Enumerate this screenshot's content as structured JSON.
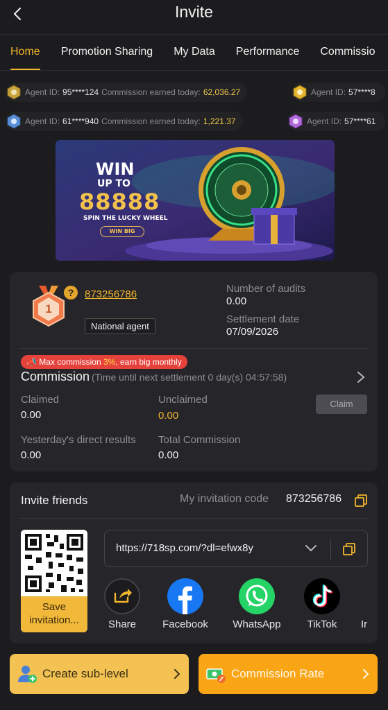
{
  "header": {
    "title": "Invite"
  },
  "tabs": [
    {
      "label": "Home",
      "active": true
    },
    {
      "label": "Promotion Sharing"
    },
    {
      "label": "My Data"
    },
    {
      "label": "Performance"
    },
    {
      "label": "Commissio"
    }
  ],
  "ticker": {
    "row1": [
      {
        "agent_label": "Agent ID:",
        "agent_id": "95****124",
        "earned_label": "Commission earned today:",
        "amount": "62,036.27"
      },
      {
        "agent_label": "Agent ID:",
        "agent_id": "57****8"
      }
    ],
    "row2": [
      {
        "agent_label": "Agent ID:",
        "agent_id": "61****940",
        "earned_label": "Commission earned today:",
        "amount": "1,221.37"
      },
      {
        "agent_label": "Agent ID:",
        "agent_id": "57****61"
      }
    ]
  },
  "banner": {
    "line1": "WIN",
    "line2": "UP TO",
    "amount": "88888",
    "caption": "SPIN THE LUCKY WHEEL",
    "button": "WIN BIG"
  },
  "agent": {
    "medal_number": "1",
    "help": "?",
    "code": "873256786",
    "level": "National agent",
    "audits_label": "Number of audits",
    "audits_value": "0.00",
    "settlement_label": "Settlement date",
    "settlement_value": "07/09/2026"
  },
  "commission": {
    "promo_prefix": "Max commission ",
    "promo_highlight": "3%",
    "promo_suffix": ", earn big monthly",
    "title": "Commission",
    "subtitle": "(Time until next settlement  0 day(s) 04:57:58)",
    "claimed_label": "Claimed",
    "claimed_value": "0.00",
    "unclaimed_label": "Unclaimed",
    "unclaimed_value": "0.00",
    "claim_button": "Claim",
    "yesterday_label": "Yesterday's direct results",
    "yesterday_value": "0.00",
    "total_label": "Total Commission",
    "total_value": "0.00"
  },
  "invite": {
    "title": "Invite friends",
    "code_label": "My invitation code",
    "code_value": "873256786",
    "qr_save_label": "Save invitation...",
    "link": "https://718sp.com/?dl=efwx8y",
    "share_items": [
      {
        "label": "Share",
        "icon": "share-icon"
      },
      {
        "label": "Facebook",
        "icon": "facebook-icon"
      },
      {
        "label": "WhatsApp",
        "icon": "whatsapp-icon"
      },
      {
        "label": "TikTok",
        "icon": "tiktok-icon"
      }
    ],
    "share_clipped": "Ir"
  },
  "bottom": {
    "create_sublevel": "Create sub-level",
    "commission_rate": "Commission Rate"
  },
  "colors": {
    "accent": "#f2b62c",
    "background": "#1c1c1f",
    "card": "#26262a",
    "promo_red": "#e5423c"
  }
}
